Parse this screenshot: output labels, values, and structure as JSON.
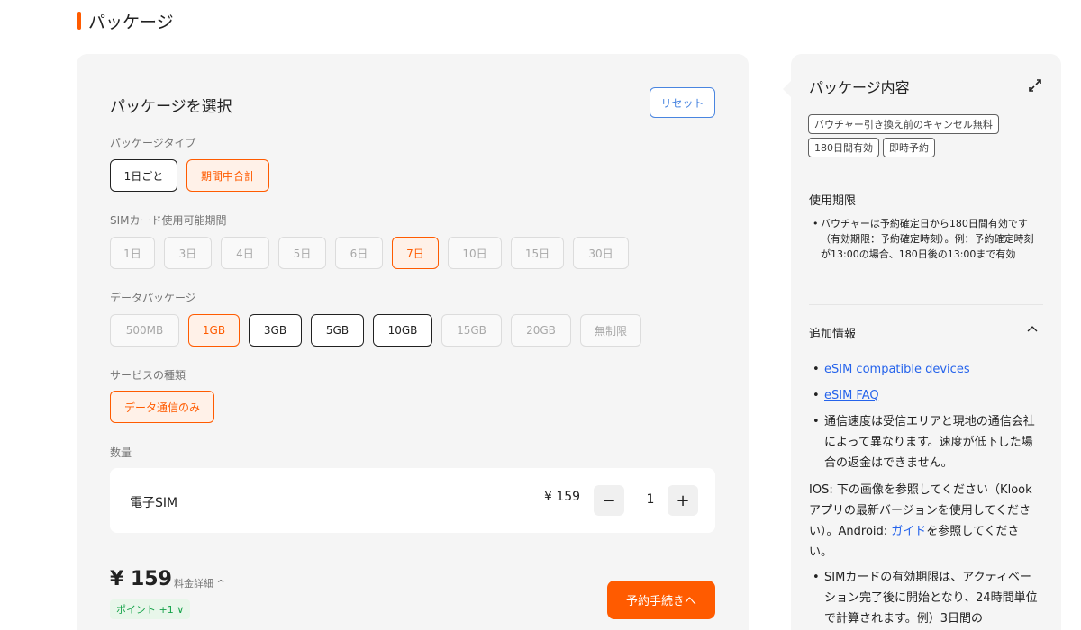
{
  "section_title": "パッケージ",
  "left": {
    "heading": "パッケージを選択",
    "reset_label": "リセット",
    "package_type": {
      "label": "パッケージタイプ",
      "options": [
        "1日ごと",
        "期間中合計"
      ]
    },
    "sim_period": {
      "label": "SIMカード使用可能期間",
      "options": [
        "1日",
        "3日",
        "4日",
        "5日",
        "6日",
        "7日",
        "10日",
        "15日",
        "30日"
      ]
    },
    "data_package": {
      "label": "データパッケージ",
      "options": [
        "500MB",
        "1GB",
        "3GB",
        "5GB",
        "10GB",
        "15GB",
        "20GB",
        "無制限"
      ]
    },
    "service_type": {
      "label": "サービスの種類",
      "options": [
        "データ通信のみ"
      ]
    },
    "quantity": {
      "label": "数量",
      "item_name": "電子SIM",
      "price": "¥ 159",
      "minus": "−",
      "value": "1",
      "plus": "+"
    },
    "total_price": "¥ 159",
    "fee_details": "料金詳細 ^",
    "points": "ポイント +1 ∨",
    "book_label": "予約手続きへ"
  },
  "right": {
    "title": "パッケージ内容",
    "tags": [
      "バウチャー引き換え前のキャンセル無料",
      "180日間有効",
      "即時予約"
    ],
    "validity_title": "使用期限",
    "validity_text": "バウチャーは予約確定日から180日間有効です（有効期限：予約確定時刻）。例：予約確定時刻が13:00の場合、180日後の13:00まで有効",
    "additional_title": "追加情報",
    "link_devices": "eSIM compatible devices",
    "link_faq": "eSIM FAQ",
    "speed_note": "通信速度は受信エリアと現地の通信会社によって異なります。速度が低下した場合の返金はできません。",
    "ios_text_1": "IOS: 下の画像を参照してください（Klookアプリの最新バージョンを使用してください）。Android: ",
    "guide_link": "ガイド",
    "ios_text_2": "を参照してください。",
    "sim_validity": "SIMカードの有効期限は、アクティベーション完了後に開始となり、24時間単位で計算されます。例）3日間の"
  },
  "colors": {
    "accent": "#ff5b00",
    "link": "#2563eb",
    "reset": "#4985e0",
    "points_green": "#16a34a"
  }
}
